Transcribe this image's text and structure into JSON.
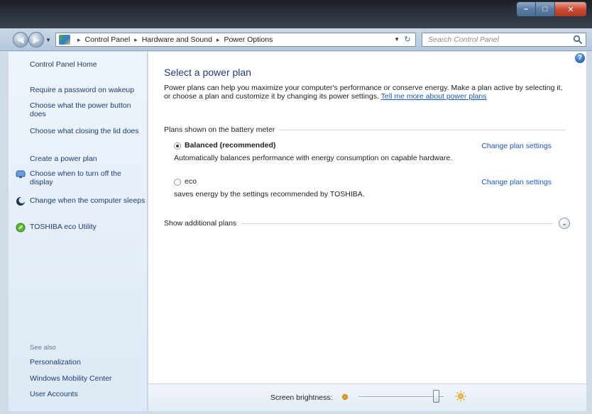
{
  "window": {
    "caption_buttons": {
      "minimize": "–",
      "maximize": "□",
      "close": "✕"
    }
  },
  "nav": {
    "breadcrumbs": [
      "Control Panel",
      "Hardware and Sound",
      "Power Options"
    ],
    "search_placeholder": "Search Control Panel"
  },
  "sidebar": {
    "home": "Control Panel Home",
    "tasks": [
      {
        "label": "Require a password on wakeup",
        "icon": ""
      },
      {
        "label": "Choose what the power button does",
        "icon": ""
      },
      {
        "label": "Choose what closing the lid does",
        "icon": ""
      },
      {
        "label": "Create a power plan",
        "icon": ""
      },
      {
        "label": "Choose when to turn off the display",
        "icon": "monitor-icon"
      },
      {
        "label": "Change when the computer sleeps",
        "icon": "moon-icon"
      },
      {
        "label": "TOSHIBA eco Utility",
        "icon": "eco-leaf-icon"
      }
    ],
    "see_also_heading": "See also",
    "see_also": [
      "Personalization",
      "Windows Mobility Center",
      "User Accounts"
    ]
  },
  "main": {
    "title": "Select a power plan",
    "intro": "Power plans can help you maximize your computer's performance or conserve energy. Make a plan active by selecting it, or choose a plan and customize it by changing its power settings.",
    "intro_link": "Tell me more about power plans",
    "plans_header": "Plans shown on the battery meter",
    "plans": [
      {
        "name": "Balanced (recommended)",
        "description": "Automatically balances performance with energy consumption on capable hardware.",
        "selected": true,
        "change_link": "Change plan settings"
      },
      {
        "name": "eco",
        "description": "saves energy by the settings recommended by TOSHIBA.",
        "selected": false,
        "change_link": "Change plan settings"
      }
    ],
    "show_additional": "Show additional plans"
  },
  "bottom": {
    "brightness_label": "Screen brightness:",
    "brightness_fraction": 0.95
  },
  "colors": {
    "link": "#1a58b4",
    "title": "#1e3c78",
    "nav_pane": "#e6eff9"
  }
}
